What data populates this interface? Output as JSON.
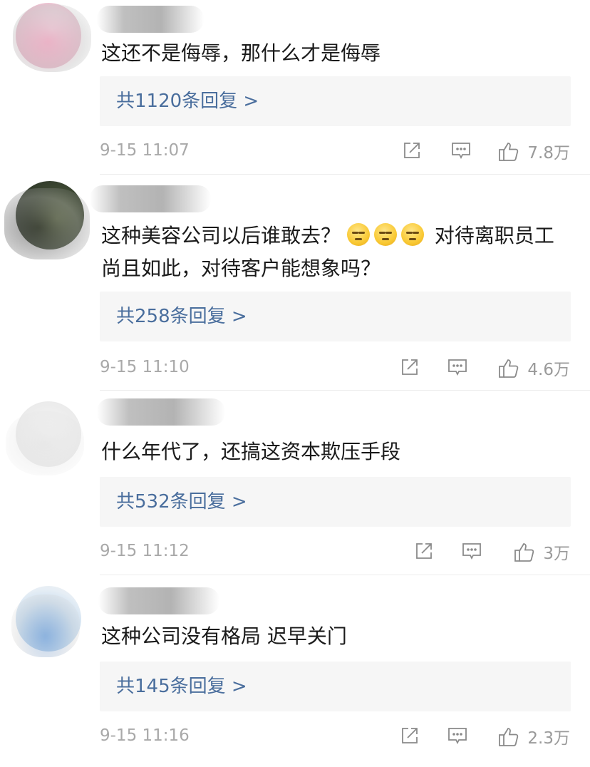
{
  "comments": [
    {
      "text": "这还不是侮辱，那什么才是侮辱",
      "replies_label": "共1120条回复 >",
      "time": "9-15 11:07",
      "likes": "7.8万"
    },
    {
      "text_before_emoji": "这种美容公司以后谁敢去？",
      "emoji_count": 3,
      "emoji_name": "speechless-face-emoji",
      "text_after_emoji": "对待离职员工尚且如此，对待客户能想象吗？",
      "replies_label": "共258条回复 >",
      "time": "9-15 11:10",
      "likes": "4.6万"
    },
    {
      "text": "什么年代了，还搞这资本欺压手段",
      "replies_label": "共532条回复 >",
      "time": "9-15 11:12",
      "likes": "3万"
    },
    {
      "text": "这种公司没有格局 迟早关门",
      "replies_label": "共145条回复 >",
      "time": "9-15 11:16",
      "likes": "2.3万"
    }
  ],
  "icons": {
    "share": "share-icon",
    "comment": "comment-icon",
    "like": "thumbs-up-icon"
  },
  "colors": {
    "reply_link": "#4a6e9d",
    "reply_bg": "#f6f6f6",
    "meta_text": "#a9a9a9"
  }
}
